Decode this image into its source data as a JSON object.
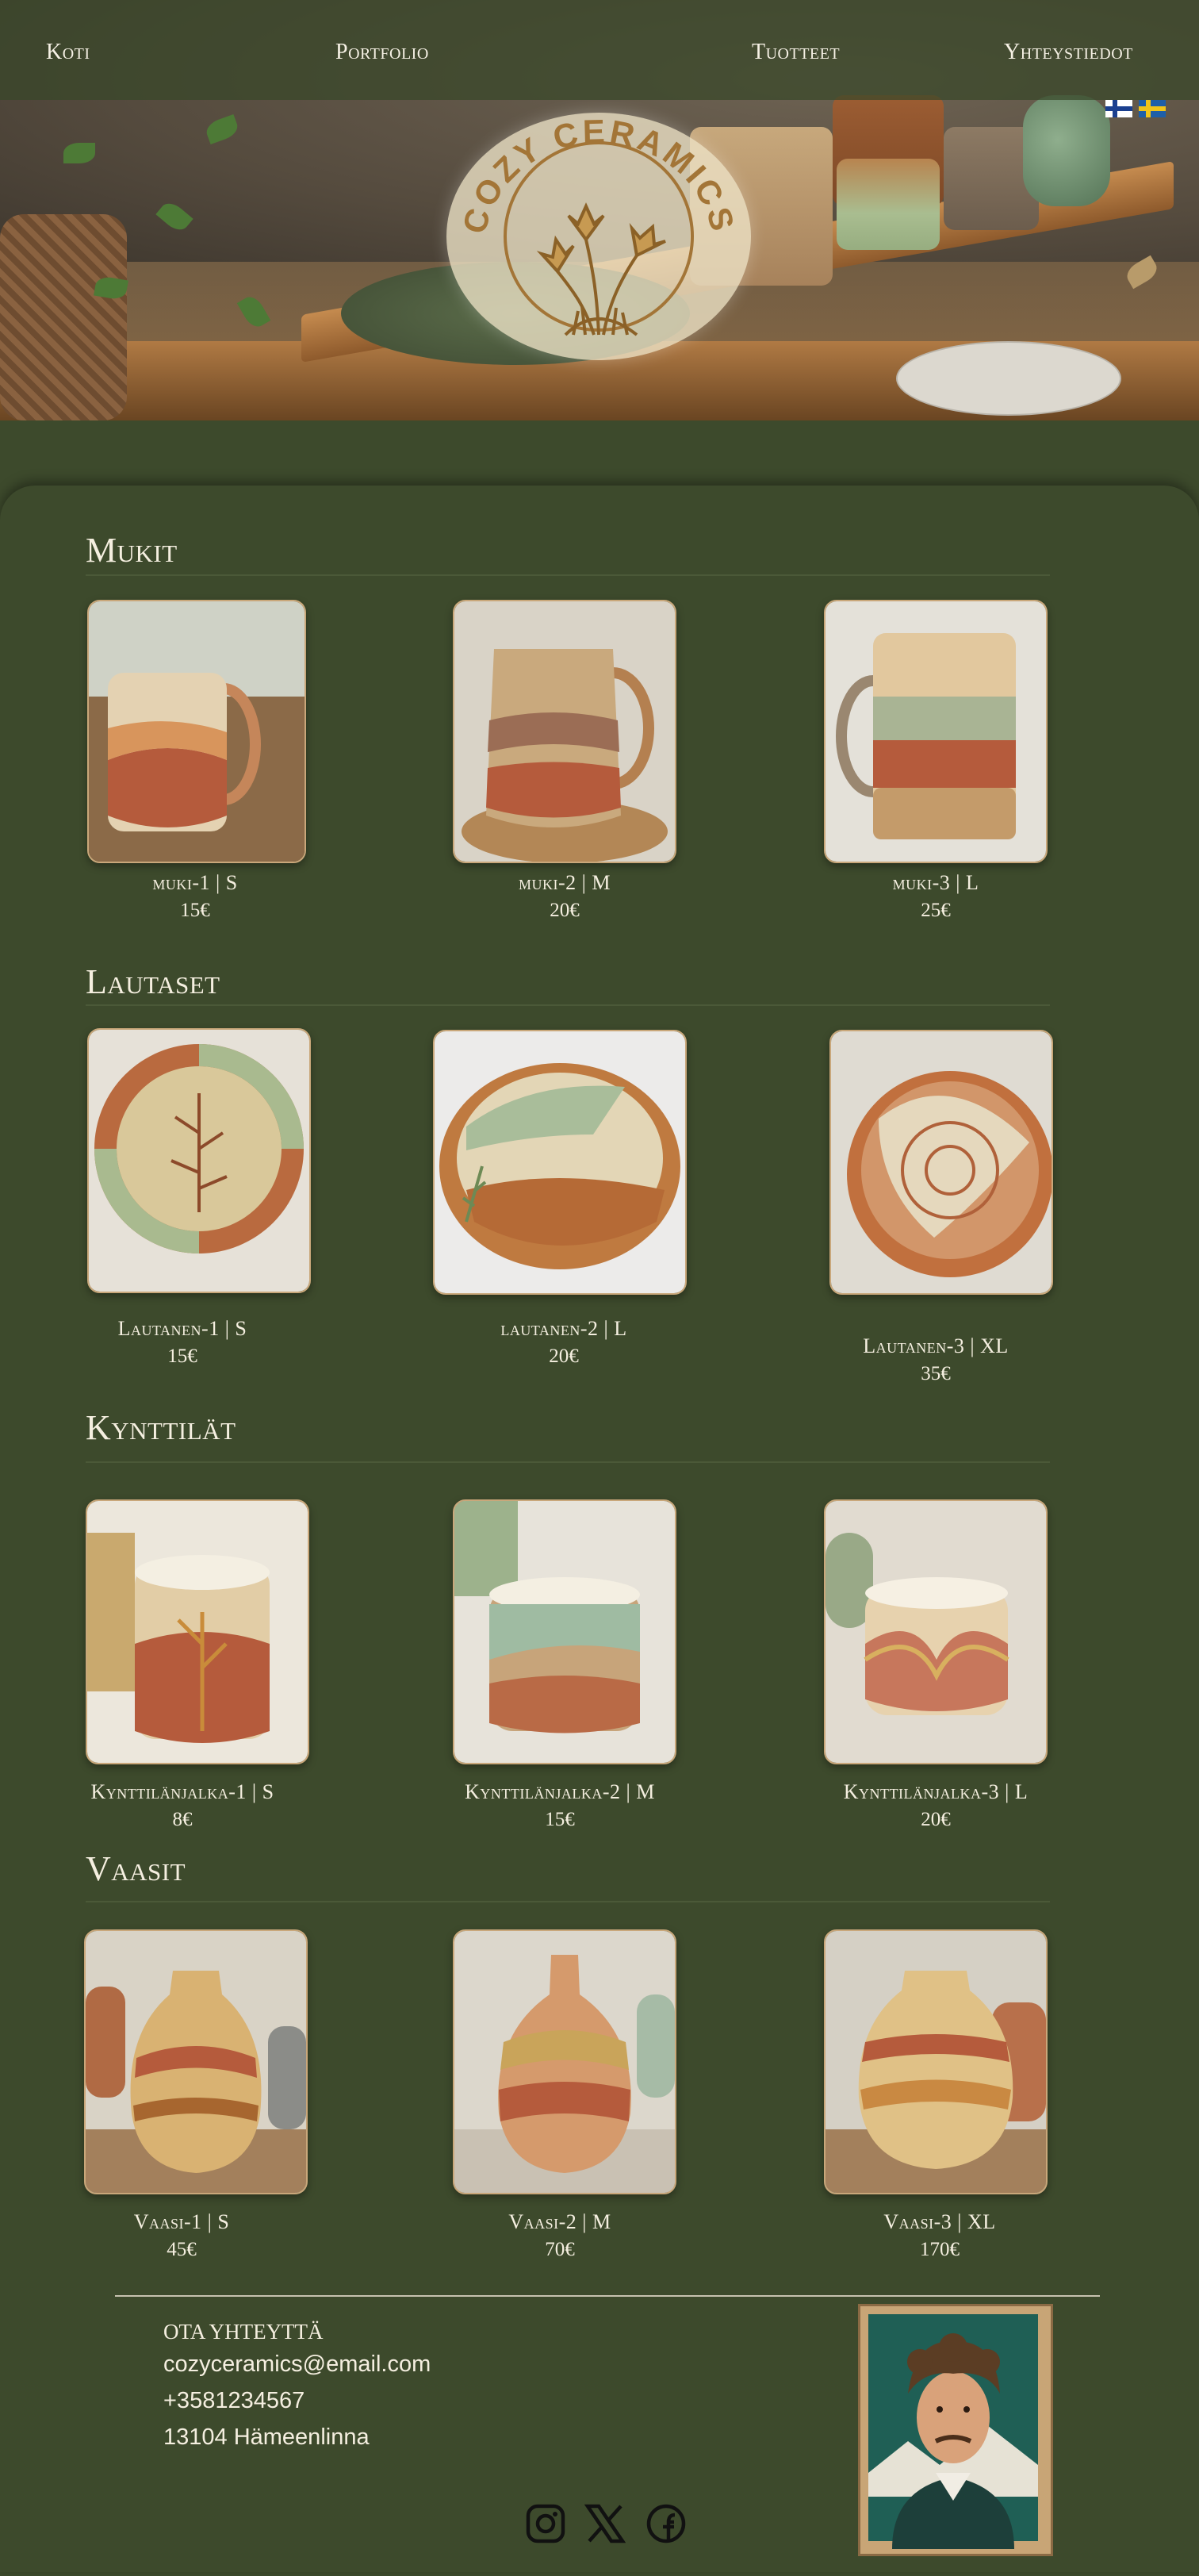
{
  "nav": {
    "items": [
      {
        "label": "Koti"
      },
      {
        "label": "Portfolio"
      },
      {
        "label": "Tuotteet"
      },
      {
        "label": "Yhteystiedot"
      }
    ],
    "languages": [
      "fi",
      "sv"
    ]
  },
  "hero": {
    "logo_text": "COZY CERAMICS"
  },
  "sections": [
    {
      "title": "Mukit",
      "products": [
        {
          "name": "muki-1 | S",
          "price": "15€"
        },
        {
          "name": "muki-2 | M",
          "price": "20€"
        },
        {
          "name": "muki-3 | L",
          "price": "25€"
        }
      ]
    },
    {
      "title": "Lautaset",
      "products": [
        {
          "name": "Lautanen-1 | S",
          "price": "15€"
        },
        {
          "name": "lautanen-2 | L",
          "price": "20€"
        },
        {
          "name": "Lautanen-3 | XL",
          "price": "35€"
        }
      ]
    },
    {
      "title": "Kynttilät",
      "products": [
        {
          "name": "Kynttilänjalka-1 | S",
          "price": "8€"
        },
        {
          "name": "Kynttilänjalka-2 | M",
          "price": "15€"
        },
        {
          "name": "Kynttilänjalka-3 | L",
          "price": "20€"
        }
      ]
    },
    {
      "title": "Vaasit",
      "products": [
        {
          "name": "Vaasi-1 | S",
          "price": "45€"
        },
        {
          "name": "Vaasi-2 | M",
          "price": "70€"
        },
        {
          "name": "Vaasi-3 | XL",
          "price": "170€"
        }
      ]
    }
  ],
  "footer": {
    "contact_title": "OTA YHTEYTTÄ",
    "email": "cozyceramics@email.com",
    "phone": "+3581234567",
    "address": "13104 Hämeenlinna",
    "social": [
      "instagram-icon",
      "x-icon",
      "facebook-icon"
    ]
  },
  "colors": {
    "background": "#3d4a2c",
    "text": "#f5efe0",
    "card_border": "#c9a77a",
    "terracotta": "#b55b3c",
    "sage": "#9db28c",
    "cream": "#e9dcc0"
  }
}
